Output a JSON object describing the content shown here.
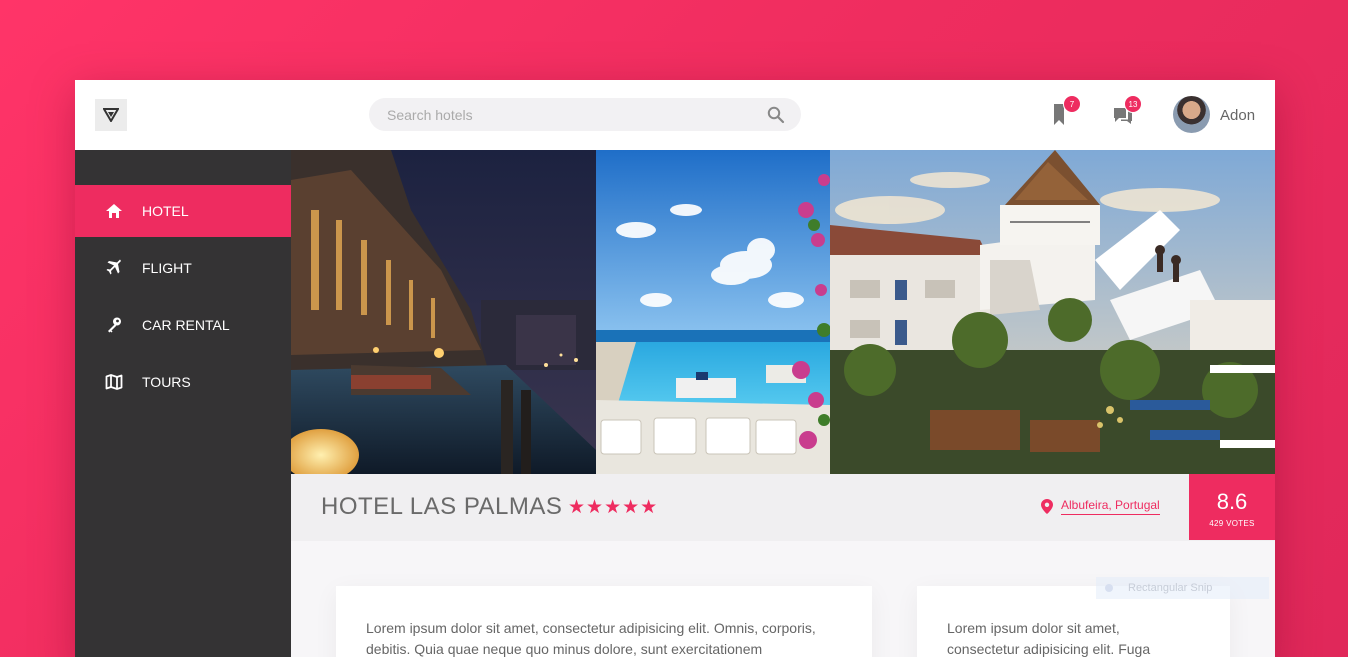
{
  "header": {
    "search_placeholder": "Search hotels",
    "bookmarks_count": "7",
    "messages_count": "13",
    "user_name": "Adon"
  },
  "sidebar": {
    "items": [
      {
        "label": "HOTEL",
        "icon": "home-icon",
        "active": true
      },
      {
        "label": "FLIGHT",
        "icon": "plane-icon",
        "active": false
      },
      {
        "label": "CAR RENTAL",
        "icon": "key-icon",
        "active": false
      },
      {
        "label": "TOURS",
        "icon": "map-icon",
        "active": false
      }
    ]
  },
  "hotel": {
    "name": "HOTEL LAS PALMAS",
    "stars": "★★★★★",
    "location": "Albufeira, Portugal",
    "score": "8.6",
    "votes": "429 VOTES"
  },
  "content": {
    "card1_text": "Lorem ipsum dolor sit amet, consectetur adipisicing elit. Omnis, corporis, debitis. Quia quae neque quo minus dolore, sunt exercitationem",
    "card2_text": "Lorem ipsum dolor sit amet, consectetur adipisicing elit. Fuga",
    "snip_label": "Rectangular Snip"
  },
  "colors": {
    "accent": "#ee2c60",
    "sidebar": "#343334",
    "background": "#ff3468"
  }
}
